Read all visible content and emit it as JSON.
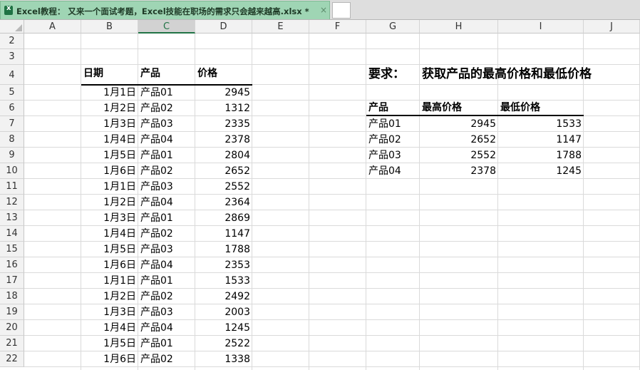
{
  "window": {
    "tab_title": "Excel教程： 又来一个面试考题，Excel技能在职场的需求只会越来越高.xlsx *",
    "close_glyph": "×"
  },
  "columns": [
    "A",
    "B",
    "C",
    "D",
    "E",
    "F",
    "G",
    "H",
    "I",
    "J"
  ],
  "rows": [
    "2",
    "3",
    "4",
    "5",
    "6",
    "7",
    "8",
    "9",
    "10",
    "11",
    "12",
    "13",
    "14",
    "15",
    "16",
    "17",
    "18",
    "19",
    "20",
    "21",
    "22"
  ],
  "selected_column": "C",
  "data_table": {
    "headers": [
      "日期",
      "产品",
      "价格"
    ],
    "rows": [
      [
        "1月1日",
        "产品01",
        "2945"
      ],
      [
        "1月2日",
        "产品02",
        "1312"
      ],
      [
        "1月3日",
        "产品03",
        "2335"
      ],
      [
        "1月4日",
        "产品04",
        "2378"
      ],
      [
        "1月5日",
        "产品01",
        "2804"
      ],
      [
        "1月6日",
        "产品02",
        "2652"
      ],
      [
        "1月1日",
        "产品03",
        "2552"
      ],
      [
        "1月2日",
        "产品04",
        "2364"
      ],
      [
        "1月3日",
        "产品01",
        "2869"
      ],
      [
        "1月4日",
        "产品02",
        "1147"
      ],
      [
        "1月5日",
        "产品03",
        "1788"
      ],
      [
        "1月6日",
        "产品04",
        "2353"
      ],
      [
        "1月1日",
        "产品01",
        "1533"
      ],
      [
        "1月2日",
        "产品02",
        "2492"
      ],
      [
        "1月3日",
        "产品03",
        "2003"
      ],
      [
        "1月4日",
        "产品04",
        "1245"
      ],
      [
        "1月5日",
        "产品01",
        "2522"
      ],
      [
        "1月6日",
        "产品02",
        "1338"
      ]
    ]
  },
  "requirement": {
    "label": "要求：",
    "text": "获取产品的最高价格和最低价格"
  },
  "summary_table": {
    "headers": [
      "产品",
      "最高价格",
      "最低价格"
    ],
    "rows": [
      [
        "产品01",
        "2945",
        "1533"
      ],
      [
        "产品02",
        "2652",
        "1147"
      ],
      [
        "产品03",
        "2552",
        "1788"
      ],
      [
        "产品04",
        "2378",
        "1245"
      ]
    ]
  }
}
